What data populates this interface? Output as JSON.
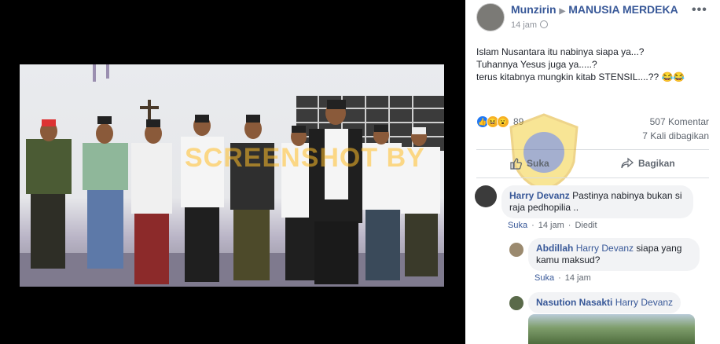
{
  "post": {
    "author": "Munzirin",
    "group": "MANUSIA MERDEKA",
    "time": "14 jam",
    "more": "•••",
    "lines": [
      "Islam Nusantara itu nabinya siapa ya...?",
      "Tuhannya Yesus juga ya.....?",
      "terus kitabnya mungkin kitab STENSIL....?? 😂😂"
    ]
  },
  "photo": {
    "watermark": "SCREENSHOT BY"
  },
  "stats": {
    "reaction_count": "89",
    "comments": "507 Komentar",
    "shares": "7 Kali dibagikan"
  },
  "actions": {
    "like": "Suka",
    "share": "Bagikan"
  },
  "comments": [
    {
      "name": "Harry Devanz",
      "text": "Pastinya nabinya bukan si raja pedhopilia ..",
      "like": "Suka",
      "time": "14 jam",
      "edited": "Diedit"
    },
    {
      "name": "Abdillah",
      "tag": "Harry Devanz",
      "text": "siapa yang kamu maksud?",
      "like": "Suka",
      "time": "14 jam"
    },
    {
      "name": "Nasution Nasakti",
      "tag": "Harry Devanz"
    }
  ],
  "colors": {
    "link": "#385898",
    "muted": "#606770",
    "bubble": "#f2f3f5"
  }
}
